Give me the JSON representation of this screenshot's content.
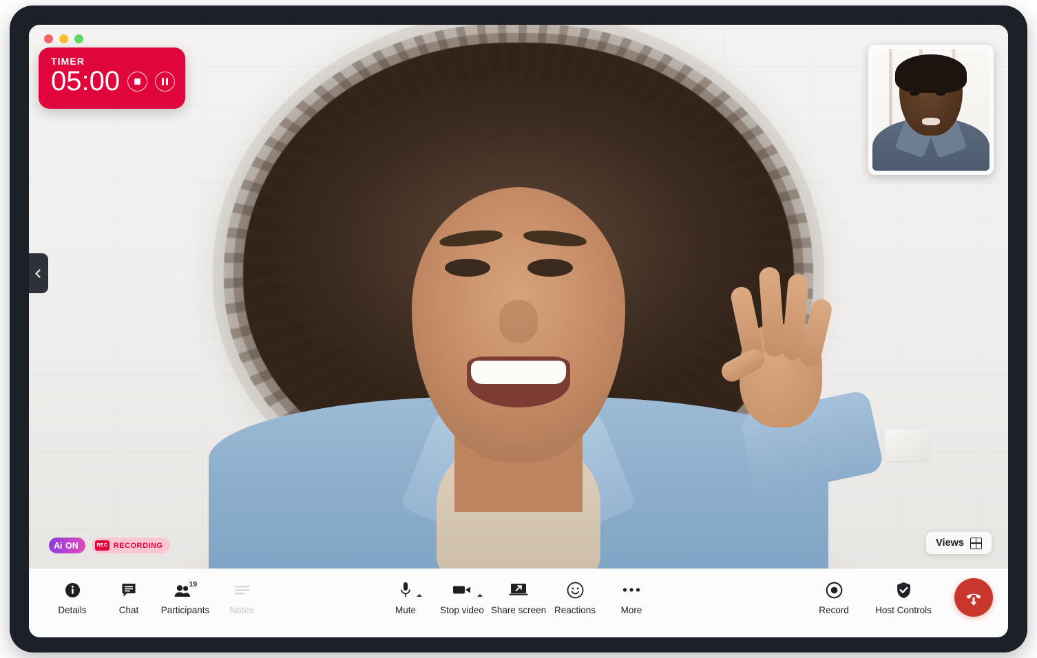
{
  "window": {
    "traffic_lights": [
      {
        "name": "close",
        "color": "#f2646a"
      },
      {
        "name": "minimize",
        "color": "#fbbd2e"
      },
      {
        "name": "maximize",
        "color": "#5fd861"
      }
    ]
  },
  "timer": {
    "label": "TIMER",
    "value": "05:00",
    "background": "#e0063c",
    "stop_button": "stop",
    "pause_button": "pause"
  },
  "stage": {
    "collapse_tab_icon": "chevron-left-icon",
    "self_view_label": "self-view"
  },
  "badges": {
    "ai": {
      "glyph": "Ai",
      "label": "ON",
      "gradient_from": "#8b3ce0",
      "gradient_to": "#e24ab4"
    },
    "recording": {
      "chip": "REC",
      "label": "RECORDING",
      "background": "#fbc7d3",
      "color": "#e0063c"
    }
  },
  "views": {
    "label": "Views",
    "icon": "grid-icon"
  },
  "toolbar": {
    "left": [
      {
        "label": "Details",
        "icon": "info-icon",
        "disabled": false
      },
      {
        "label": "Chat",
        "icon": "chat-icon",
        "disabled": false
      },
      {
        "label": "Participants",
        "icon": "participants-icon",
        "badge": "19",
        "disabled": false
      },
      {
        "label": "Notes",
        "icon": "notes-icon",
        "disabled": true
      }
    ],
    "center": [
      {
        "label": "Mute",
        "icon": "microphone-icon",
        "has_caret": true
      },
      {
        "label": "Stop video",
        "icon": "video-camera-icon",
        "has_caret": true
      },
      {
        "label": "Share screen",
        "icon": "share-screen-icon",
        "has_caret": false
      },
      {
        "label": "Reactions",
        "icon": "smiley-icon",
        "has_caret": false
      },
      {
        "label": "More",
        "icon": "ellipsis-icon",
        "has_caret": false
      }
    ],
    "right": [
      {
        "label": "Record",
        "icon": "record-icon"
      },
      {
        "label": "Host Controls",
        "icon": "shield-check-icon"
      }
    ],
    "end_call": {
      "icon": "hang-up-icon",
      "color": "#c9362c"
    }
  }
}
